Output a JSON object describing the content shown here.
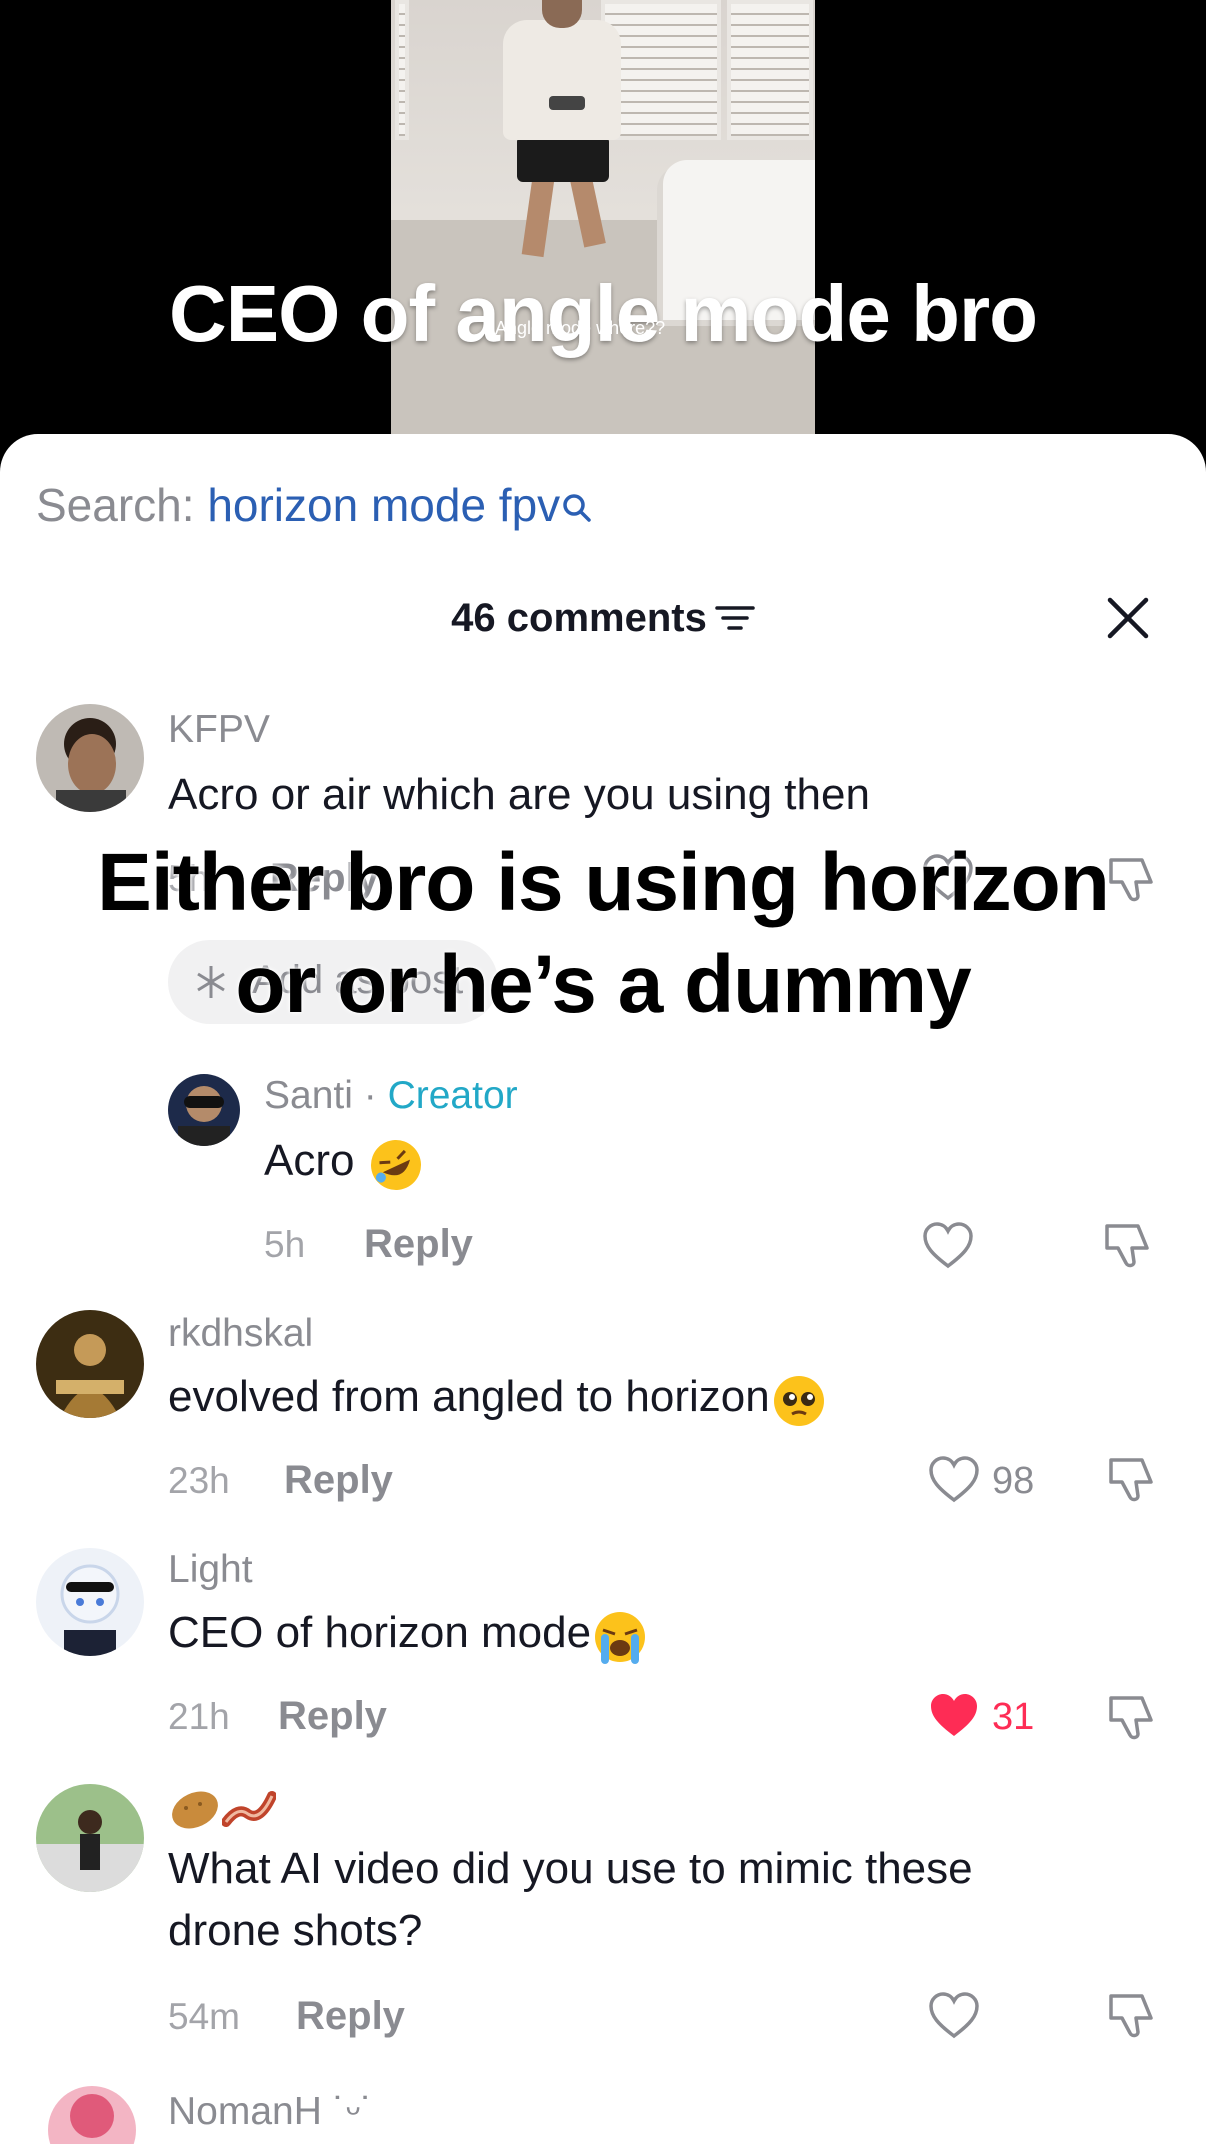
{
  "video": {
    "caption": "CEO of angle mode bro",
    "subcaption": "Angle mode where??"
  },
  "search": {
    "label": "Search: ",
    "term": "horizon mode fpv"
  },
  "comments_header": {
    "count_label": "46 comments"
  },
  "overlay": {
    "line1": "Either bro is using horizon",
    "line2": "or or he’s a dummy"
  },
  "comments": [
    {
      "username": "KFPV",
      "text": "Acro or air which are you using then",
      "time": "5h",
      "reply": "Reply",
      "add_post": "Add as post"
    },
    {
      "username": "Santi",
      "separator": " · ",
      "badge": "Creator",
      "text": "Acro",
      "emoji": "rofl-emoji",
      "time": "5h",
      "reply": "Reply"
    },
    {
      "username": "rkdhskal",
      "text": "evolved from angled to horizon",
      "emoji": "pleading-face-emoji",
      "time": "23h",
      "reply": "Reply",
      "likes": "98"
    },
    {
      "username": "Light",
      "text": "CEO of horizon mode",
      "emoji": "loudly-crying-emoji",
      "time": "21h",
      "reply": "Reply",
      "likes": "31",
      "liked": true
    },
    {
      "username_emojis": [
        "potato-emoji",
        "bacon-emoji"
      ],
      "text_line1": "What AI video did you use to mimic these",
      "text_line2": "drone shots?",
      "time": "54m",
      "reply": "Reply"
    },
    {
      "username": "NomanH ˙ᵕ˙"
    }
  ],
  "colors": {
    "accent_link": "#2b5fb3",
    "creator": "#22a8c7",
    "liked_heart": "#fe2c55",
    "muted_text": "#8a8b91"
  }
}
